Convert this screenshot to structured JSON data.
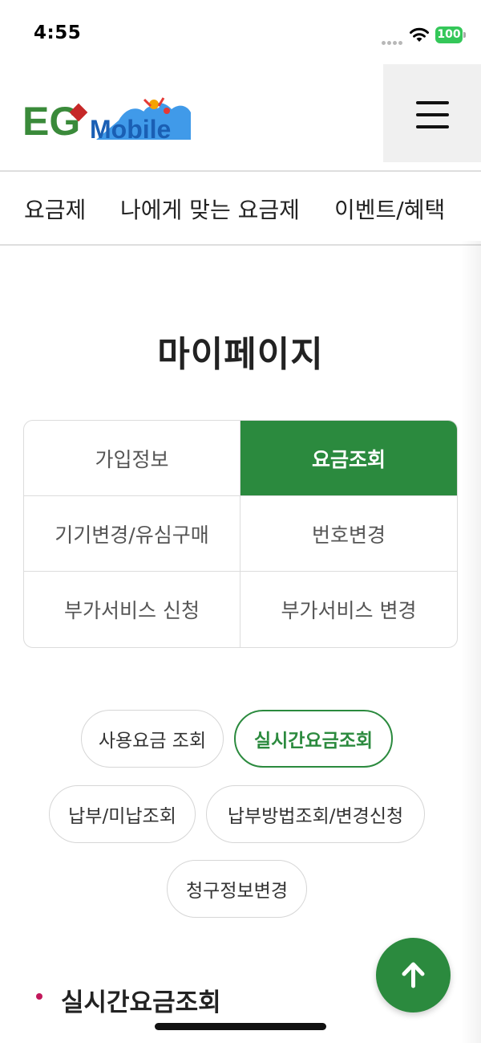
{
  "status_bar": {
    "time": "4:55",
    "battery": "100"
  },
  "header": {
    "logo": {
      "letters": "EG",
      "wordmark": "Mobile"
    },
    "menu_icon": "hamburger-icon"
  },
  "nav": {
    "items": [
      "요금제",
      "나에게 맞는 요금제",
      "이벤트/혜택"
    ]
  },
  "page_title": "마이페이지",
  "menu_grid": {
    "items": [
      {
        "label": "가입정보"
      },
      {
        "label": "요금조회"
      },
      {
        "label": "기기변경/유심구매"
      },
      {
        "label": "번호변경"
      },
      {
        "label": "부가서비스 신청"
      },
      {
        "label": "부가서비스 변경"
      }
    ],
    "active": "요금조회"
  },
  "sub_menu": {
    "items": [
      {
        "label": "사용요금 조회"
      },
      {
        "label": "실시간요금조회"
      },
      {
        "label": "납부/미납조회"
      },
      {
        "label": "납부방법조회/변경신청"
      },
      {
        "label": "청구정보변경"
      }
    ],
    "active": "실시간요금조회"
  },
  "section": {
    "title": "실시간요금조회"
  },
  "scroll_top_icon": "arrow-up-icon",
  "colors": {
    "accent": "#2b8a3e",
    "bullet": "#c2185b",
    "battery": "#34c759"
  }
}
